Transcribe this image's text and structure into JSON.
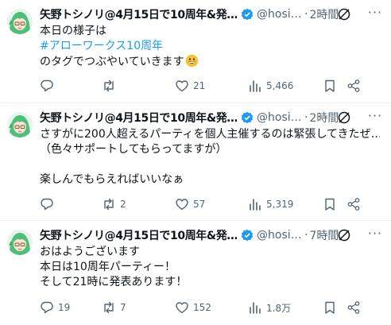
{
  "colors": {
    "accent": "#1d9bf0",
    "muted": "#536471",
    "text": "#0f1419",
    "divider": "#eff3f4"
  },
  "posts": [
    {
      "author": "矢野トシノリ@4月15日で10周年&発…",
      "handle": "@hosi…",
      "separator": "·",
      "time": "2時間",
      "body": {
        "line1": "本日の様子は",
        "hashtag": "#アローワークス10周年",
        "line3": "のタグでつぶやいていきます",
        "emoji": "grinning-face"
      },
      "replies": "",
      "retweets": "",
      "likes": "21",
      "views": "5,466"
    },
    {
      "author": "矢野トシノリ@4月15日で10周年&発…",
      "handle": "@hosi…",
      "separator": "·",
      "time": "2時間",
      "body": {
        "line1": "さすがに200人超えるパーティを個人主催するのは緊張してきたぜ…",
        "line2": "（色々サポートしてもらってますが）",
        "line3": "",
        "line4": "楽しんでもらえればいいなぁ"
      },
      "replies": "",
      "retweets": "2",
      "likes": "57",
      "views": "5,319"
    },
    {
      "author": "矢野トシノリ@4月15日で10周年&発…",
      "handle": "@hosi…",
      "separator": "·",
      "time": "7時間",
      "body": {
        "line1": "おはようございます",
        "line2": "本日は10周年パーティー！",
        "line3": "そして21時に発表あります！"
      },
      "replies": "19",
      "retweets": "7",
      "likes": "152",
      "views": "1.8万"
    }
  ]
}
